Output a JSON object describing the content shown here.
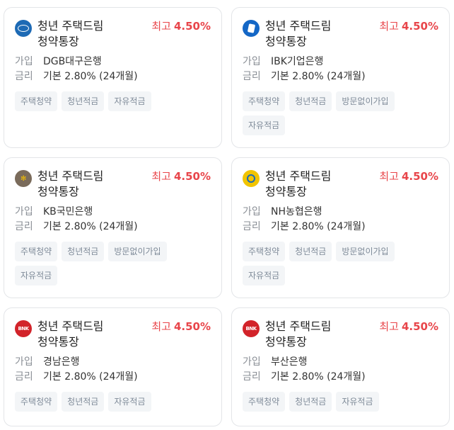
{
  "labels": {
    "join": "가입",
    "rate": "금리"
  },
  "colors": {
    "rate_accent": "#e8454a",
    "tag_bg": "#f3f5f7",
    "tag_text": "#7e8a98"
  },
  "cards": [
    {
      "title": "청년 주택드림 청약통장",
      "rate_label": "최고",
      "rate_value": "4.50%",
      "bank": "DGB대구은행",
      "base_rate": "기본 2.80% (24개월)",
      "logo_icon": "dgb-logo-icon",
      "tags": [
        "주택청약",
        "청년적금",
        "자유적금"
      ]
    },
    {
      "title": "청년 주택드림 청약통장",
      "rate_label": "최고",
      "rate_value": "4.50%",
      "bank": "IBK기업은행",
      "base_rate": "기본 2.80% (24개월)",
      "logo_icon": "ibk-logo-icon",
      "tags": [
        "주택청약",
        "청년적금",
        "방문없이가입",
        "자유적금"
      ]
    },
    {
      "title": "청년 주택드림 청약통장",
      "rate_label": "최고",
      "rate_value": "4.50%",
      "bank": "KB국민은행",
      "base_rate": "기본 2.80% (24개월)",
      "logo_icon": "kb-logo-icon",
      "tags": [
        "주택청약",
        "청년적금",
        "방문없이가입",
        "자유적금"
      ]
    },
    {
      "title": "청년 주택드림 청약통장",
      "rate_label": "최고",
      "rate_value": "4.50%",
      "bank": "NH농협은행",
      "base_rate": "기본 2.80% (24개월)",
      "logo_icon": "nh-logo-icon",
      "tags": [
        "주택청약",
        "청년적금",
        "방문없이가입",
        "자유적금"
      ]
    },
    {
      "title": "청년 주택드림 청약통장",
      "rate_label": "최고",
      "rate_value": "4.50%",
      "bank": "경남은행",
      "base_rate": "기본 2.80% (24개월)",
      "logo_icon": "bnk-logo-icon",
      "logo_text": "BNK",
      "tags": [
        "주택청약",
        "청년적금",
        "자유적금"
      ]
    },
    {
      "title": "청년 주택드림 청약통장",
      "rate_label": "최고",
      "rate_value": "4.50%",
      "bank": "부산은행",
      "base_rate": "기본 2.80% (24개월)",
      "logo_icon": "bnk-logo-icon",
      "logo_text": "BNK",
      "tags": [
        "주택청약",
        "청년적금",
        "자유적금"
      ]
    }
  ]
}
